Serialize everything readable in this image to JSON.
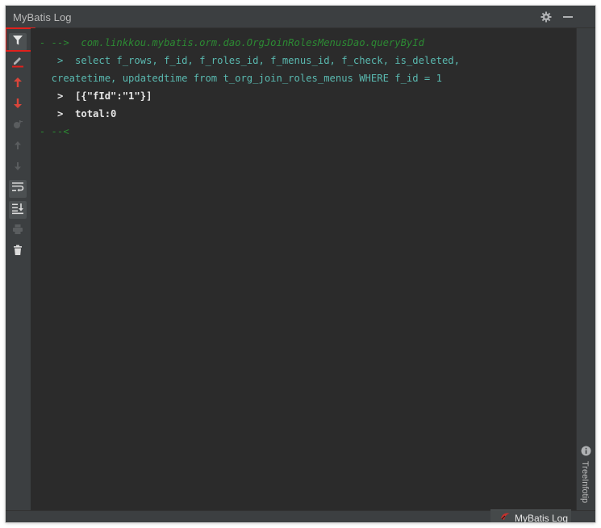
{
  "window": {
    "title": "MyBatis Log",
    "settings_icon": "gear-icon",
    "minimize_icon": "minimize-icon"
  },
  "toolbar": {
    "items": [
      {
        "name": "filter-icon",
        "active": true
      },
      {
        "name": "clear-icon"
      },
      {
        "name": "arrow-up-icon"
      },
      {
        "name": "arrow-down-icon"
      },
      {
        "name": "analyze-icon"
      },
      {
        "name": "scroll-up-icon"
      },
      {
        "name": "scroll-down-icon"
      },
      {
        "name": "soft-wrap-icon"
      },
      {
        "name": "scroll-to-end-icon"
      },
      {
        "name": "print-icon"
      },
      {
        "name": "delete-icon"
      }
    ]
  },
  "console": {
    "lines": [
      {
        "text": "- -->  com.linkkou.mybatis.orm.dao.OrgJoinRolesMenusDao.queryById",
        "style": "green-italic"
      },
      {
        "text": "   >  select f_rows, f_id, f_roles_id, f_menus_id, f_check, is_deleted,",
        "style": "cyan"
      },
      {
        "text": "  createtime, updatedtime from t_org_join_roles_menus WHERE f_id = 1",
        "style": "cyan"
      },
      {
        "text": "   >  [{\"fId\":\"1\"}]",
        "style": "white"
      },
      {
        "text": "   >  total:0",
        "style": "white"
      },
      {
        "text": "- --<",
        "style": "green-italic"
      }
    ]
  },
  "right_sidebar": {
    "tab_label": "TreeInfotip",
    "tab_icon": "info-icon"
  },
  "status_bar": {
    "tab_label": "MyBatis Log",
    "tab_icon": "mybatis-icon"
  },
  "colors": {
    "console_bg": "#2b2b2b",
    "panel_bg": "#3c3f41",
    "highlight_red": "#e0201c",
    "sql_text": "#5ab9b0",
    "method_text": "#2c8a33"
  }
}
